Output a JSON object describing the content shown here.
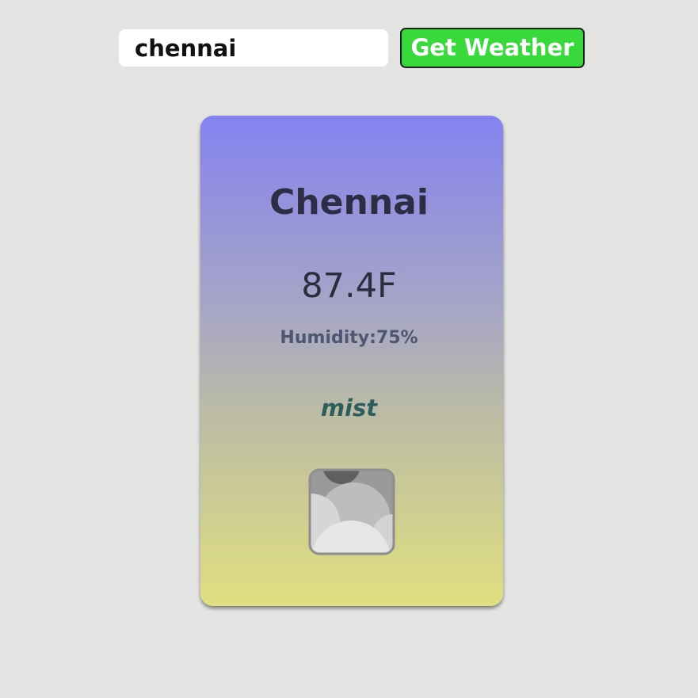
{
  "search": {
    "value": "chennai",
    "button_label": "Get Weather"
  },
  "weather": {
    "city": "Chennai",
    "temperature": "87.4F",
    "humidity": "Humidity:75%",
    "description": "mist",
    "icon": "mist-clouds-icon"
  },
  "colors": {
    "page_background": "#e4e4e2",
    "button_green": "#38d93a",
    "card_gradient_top": "#8482ef",
    "card_gradient_bottom": "#e0df7f",
    "city_text": "#2d2d45",
    "humidity_text": "#4d5772",
    "description_text": "#2d5e5e"
  }
}
